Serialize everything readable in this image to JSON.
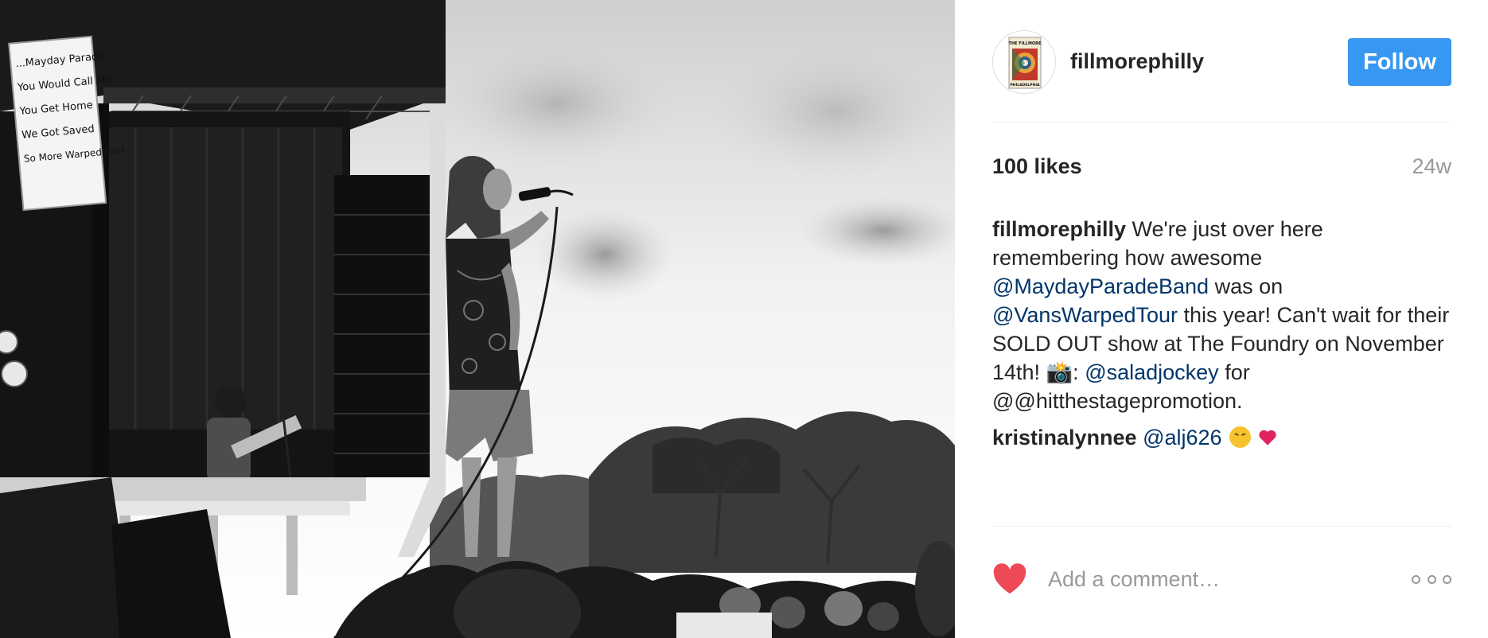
{
  "post": {
    "image_alt": "",
    "header": {
      "username": "fillmorephilly",
      "follow_label": "Follow",
      "avatar_text_top": "THE FILLMORE",
      "avatar_text_bottom": "PHILADELPHIA"
    },
    "likes": "100 likes",
    "age": "24w",
    "caption": {
      "user": "fillmorephilly",
      "text_1": " We're just over here remembering how awesome ",
      "mention_1": "@MaydayParadeBand",
      "text_2": " was on ",
      "mention_2": "@VansWarpedTour",
      "text_3": " this year! Can't wait for their SOLD OUT show at The Foundry on November 14th! 📸: ",
      "mention_3": "@saladjockey",
      "text_4": " for @@hitthestagepromotion."
    },
    "comments": [
      {
        "user": "kristinalynnee",
        "mention": "@alj626"
      }
    ],
    "comment_input": {
      "placeholder": "Add a comment…"
    },
    "banner_text": [
      "...Mayday Parade",
      "You Would Call Me",
      "You Get Home",
      "We Got Saved",
      "So More Warped Tour"
    ],
    "colors": {
      "follow": "#3897f0",
      "like_heart": "#ed4956",
      "mention": "#003569",
      "muted": "#999999"
    },
    "icons": {
      "like": "heart-icon",
      "more": "more-options-icon"
    }
  }
}
